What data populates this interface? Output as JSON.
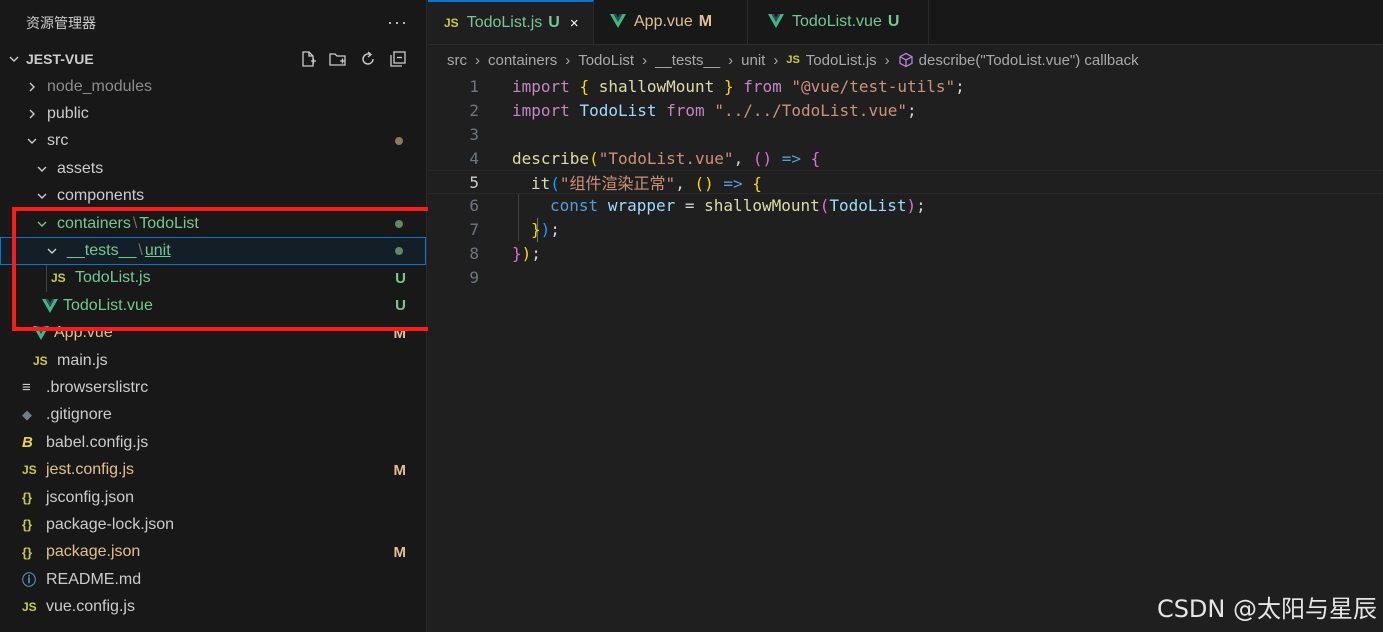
{
  "sidebar": {
    "title": "资源管理器",
    "more": "···",
    "project": "JEST-VUE",
    "items": [
      {
        "label": "node_modules",
        "icon": "",
        "kind": "folder",
        "state": "",
        "color": "#8c8c8c"
      },
      {
        "label": "public",
        "icon": "",
        "kind": "folder",
        "state": "",
        "color": "#cccccc"
      },
      {
        "label": "src",
        "icon": "",
        "kind": "folder-open",
        "state": "dot",
        "color": "#cccccc"
      },
      {
        "label": "assets",
        "icon": "",
        "kind": "folder-open",
        "state": "",
        "color": "#cccccc"
      },
      {
        "label": "components",
        "icon": "",
        "kind": "folder-open",
        "state": "",
        "color": "#cccccc"
      },
      {
        "label_a": "containers",
        "label_sep": "\\",
        "label_b": "TodoList",
        "icon": "",
        "kind": "folder-open",
        "state": "dot",
        "color": "#73c991"
      },
      {
        "label_a": "__tests__",
        "label_sep": "\\",
        "label_b": "unit",
        "icon": "",
        "kind": "folder-open",
        "state": "dot",
        "color": "#73c991"
      },
      {
        "label": "TodoList.js",
        "icon": "JS",
        "kind": "file",
        "state": "U",
        "color": "#73c991"
      },
      {
        "label": "TodoList.vue",
        "icon": "V",
        "kind": "file",
        "state": "U",
        "color": "#73c991"
      },
      {
        "label": "App.vue",
        "icon": "V",
        "kind": "file",
        "state": "M",
        "color": "#e2c08d"
      },
      {
        "label": "main.js",
        "icon": "JS",
        "kind": "file",
        "state": "",
        "color": "#cccccc"
      },
      {
        "label": ".browserslistrc",
        "icon": "≡",
        "kind": "file",
        "state": "",
        "color": "#cccccc"
      },
      {
        "label": ".gitignore",
        "icon": "◆",
        "kind": "file",
        "state": "",
        "color": "#cccccc"
      },
      {
        "label": "babel.config.js",
        "icon": "B",
        "kind": "file",
        "state": "",
        "color": "#cccccc"
      },
      {
        "label": "jest.config.js",
        "icon": "JS",
        "kind": "file",
        "state": "M",
        "color": "#e2c08d"
      },
      {
        "label": "jsconfig.json",
        "icon": "{}",
        "kind": "file",
        "state": "",
        "color": "#cccccc"
      },
      {
        "label": "package-lock.json",
        "icon": "{}",
        "kind": "file",
        "state": "",
        "color": "#cccccc"
      },
      {
        "label": "package.json",
        "icon": "{}",
        "kind": "file",
        "state": "M",
        "color": "#e2c08d"
      },
      {
        "label": "README.md",
        "icon": "ⓘ",
        "kind": "file",
        "state": "",
        "color": "#cccccc"
      },
      {
        "label": "vue.config.js",
        "icon": "JS",
        "kind": "file",
        "state": "",
        "color": "#cccccc"
      }
    ]
  },
  "tabs": [
    {
      "icon": "JS",
      "label": "TodoList.js",
      "state": "U",
      "close": "×",
      "active": true
    },
    {
      "icon": "V",
      "label": "App.vue",
      "state": "M",
      "active": false
    },
    {
      "icon": "V",
      "label": "TodoList.vue",
      "state": "U",
      "active": false
    }
  ],
  "breadcrumb": {
    "parts": [
      "src",
      "containers",
      "TodoList",
      "__tests__",
      "unit"
    ],
    "file_icon": "JS",
    "file": "TodoList.js",
    "symbol": "describe(\"TodoList.vue\") callback"
  },
  "code": {
    "line_numbers": [
      "1",
      "2",
      "3",
      "4",
      "5",
      "6",
      "7",
      "8",
      "9"
    ],
    "current_line": 5,
    "l1": {
      "k": "import",
      "b1": "{",
      "v": "shallowMount",
      "b2": "}",
      "f": "from",
      "s": "\"@vue/test-utils\"",
      "e": ";"
    },
    "l2": {
      "k": "import",
      "v": "TodoList",
      "f": "from",
      "s": "\"../../TodoList.vue\"",
      "e": ";"
    },
    "l4": {
      "fn": "describe",
      "p1": "(",
      "s": "\"TodoList.vue\"",
      "c": ", ",
      "p2": "()",
      "ar": " => ",
      "b": "{"
    },
    "l5": {
      "fn": "it",
      "p1": "(",
      "s": "\"组件渲染正常\"",
      "c": ", ",
      "p2": "()",
      "ar": " => ",
      "b": "{"
    },
    "l6": {
      "k": "const",
      "v": "wrapper",
      "eq": " = ",
      "fn": "shallowMount",
      "p1": "(",
      "a": "TodoList",
      "p2": ")",
      "e": ";"
    },
    "l7": {
      "b": "}",
      "p": ")",
      "e": ";"
    },
    "l8": {
      "b": "}",
      "p": ")",
      "e": ";"
    }
  },
  "watermark": "CSDN @太阳与星辰"
}
